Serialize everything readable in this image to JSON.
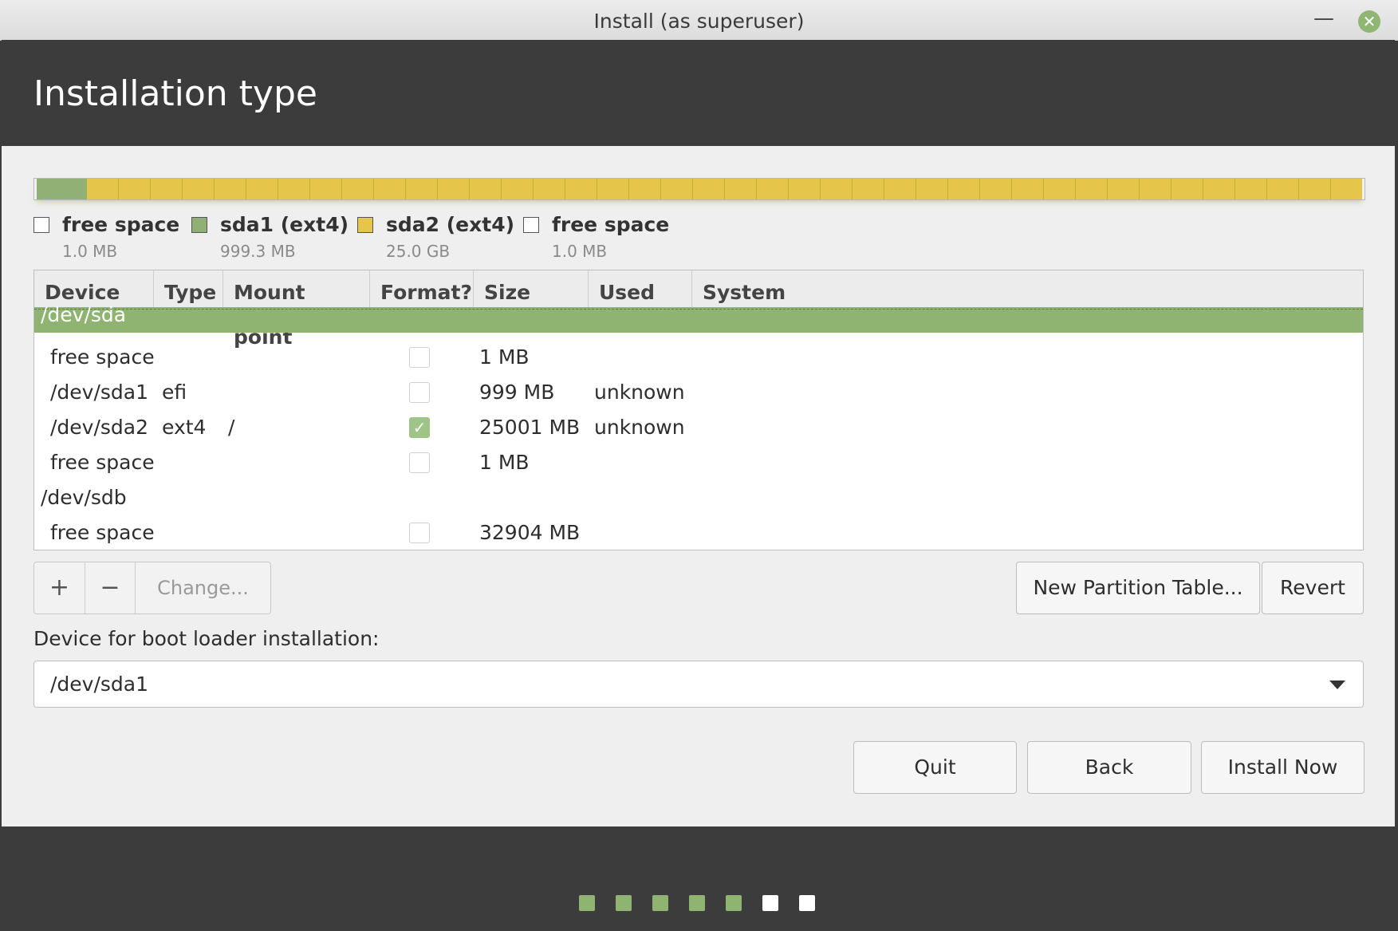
{
  "window": {
    "title": "Install (as superuser)",
    "minimize_icon": "—",
    "close_icon": "✕"
  },
  "header": {
    "title": "Installation type"
  },
  "colors": {
    "accent_green": "#8fb472",
    "ext4_green": "#91b076",
    "ext4_yellow": "#e6c64a",
    "free_space": "#f1f1f1"
  },
  "partition_bar": {
    "segments": [
      {
        "kind": "free",
        "fraction": 0.0016
      },
      {
        "kind": "ext1",
        "fraction": 0.038
      },
      {
        "kind": "ext2",
        "fraction": 0.9588
      },
      {
        "kind": "free",
        "fraction": 0.0016
      }
    ]
  },
  "legend": [
    {
      "name": "free space",
      "size": "1.0 MB",
      "swatch": "free"
    },
    {
      "name": "sda1 (ext4)",
      "size": "999.3 MB",
      "swatch": "ext1"
    },
    {
      "name": "sda2 (ext4)",
      "size": "25.0 GB",
      "swatch": "ext2"
    },
    {
      "name": "free space",
      "size": "1.0 MB",
      "swatch": "free"
    }
  ],
  "table": {
    "columns": [
      "Device",
      "Type",
      "Mount point",
      "Format?",
      "Size",
      "Used",
      "System"
    ],
    "rows": [
      {
        "device": "/dev/sda",
        "type": "",
        "mount": "",
        "format": null,
        "size": "",
        "used": "",
        "system": "",
        "group": true,
        "selected": true
      },
      {
        "device": "free space",
        "type": "",
        "mount": "",
        "format": false,
        "size": "1 MB",
        "used": "",
        "system": ""
      },
      {
        "device": "/dev/sda1",
        "type": "efi",
        "mount": "",
        "format": false,
        "size": "999 MB",
        "used": "unknown",
        "system": ""
      },
      {
        "device": "/dev/sda2",
        "type": "ext4",
        "mount": "/",
        "format": true,
        "size": "25001 MB",
        "used": "unknown",
        "system": ""
      },
      {
        "device": "free space",
        "type": "",
        "mount": "",
        "format": false,
        "size": "1 MB",
        "used": "",
        "system": ""
      },
      {
        "device": "/dev/sdb",
        "type": "",
        "mount": "",
        "format": null,
        "size": "",
        "used": "",
        "system": "",
        "group": true
      },
      {
        "device": "free space",
        "type": "",
        "mount": "",
        "format": false,
        "size": "32904 MB",
        "used": "",
        "system": ""
      }
    ]
  },
  "toolbar": {
    "add_label": "+",
    "remove_label": "−",
    "change_label": "Change...",
    "new_table_label": "New Partition Table...",
    "revert_label": "Revert"
  },
  "bootloader": {
    "label": "Device for boot loader installation:",
    "value": "/dev/sda1"
  },
  "actions": {
    "quit_label": "Quit",
    "back_label": "Back",
    "install_label": "Install Now"
  },
  "progress": {
    "total_steps": 7,
    "completed_steps": 5
  }
}
